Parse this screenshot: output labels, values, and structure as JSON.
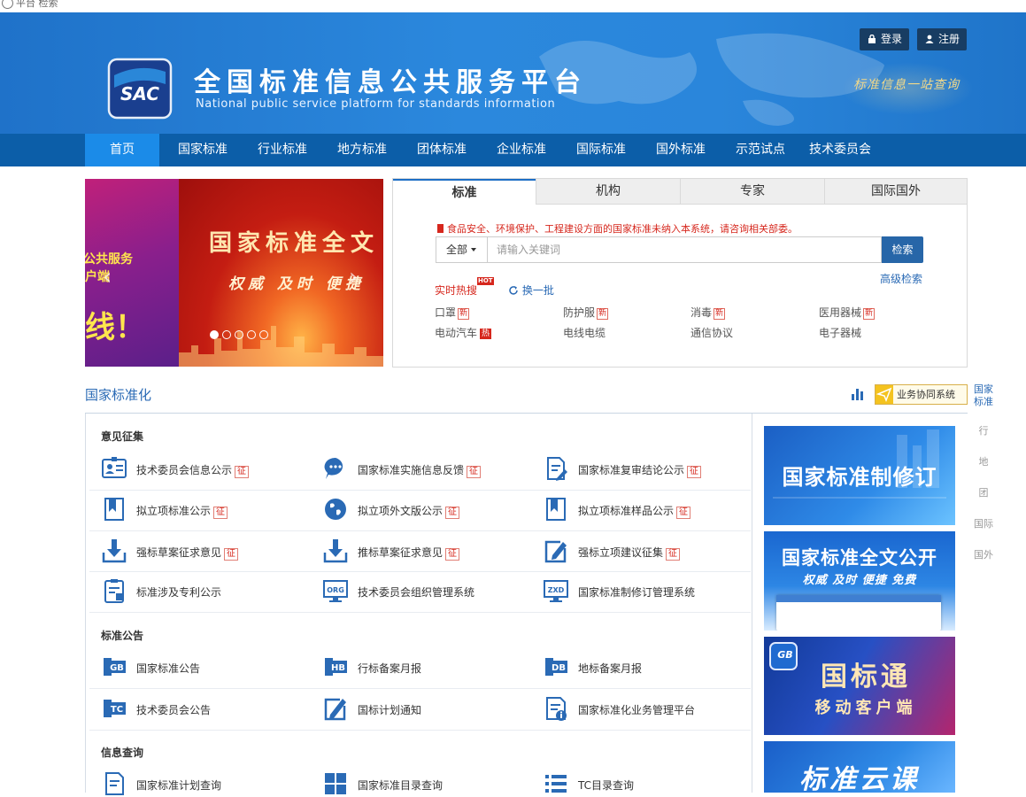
{
  "browser": {
    "tab_label": "平台 检索"
  },
  "header": {
    "login": "登录",
    "register": "注册",
    "logo_text": "SAC",
    "title": "全国标准信息公共服务平台",
    "subtitle": "National public service platform  for standards information",
    "slogan": "标准信息一站查询"
  },
  "nav": {
    "items": [
      "首页",
      "国家标准",
      "行业标准",
      "地方标准",
      "团体标准",
      "企业标准",
      "国际标准",
      "国外标准",
      "示范试点",
      "技术委员会"
    ],
    "active": "首页"
  },
  "banner": {
    "left_line1": "公共服务",
    "left_line2": "户端",
    "left_line3": "线！",
    "headline": "国家标准全文",
    "tagline": "权威  及时  便捷"
  },
  "search": {
    "tabs": [
      "标准",
      "机构",
      "专家",
      "国际国外"
    ],
    "active_tab": "标准",
    "notice": "食品安全、环境保护、工程建设方面的国家标准未纳入本系统，请咨询相关部委。",
    "scope": "全部",
    "placeholder": "请输入关键词",
    "button": "检索",
    "advanced": "高级检索",
    "hot_title": "实时热搜",
    "hot_badge": "HOT",
    "refresh": "换一批",
    "hot_terms": [
      {
        "text": "口罩",
        "tag": "新"
      },
      {
        "text": "防护服",
        "tag": "新"
      },
      {
        "text": "消毒",
        "tag": "新"
      },
      {
        "text": "医用器械",
        "tag": "新"
      },
      {
        "text": "电动汽车",
        "tag": "热"
      },
      {
        "text": "电线电缆",
        "tag": ""
      },
      {
        "text": "通信协议",
        "tag": ""
      },
      {
        "text": "电子器械",
        "tag": ""
      }
    ]
  },
  "section": {
    "title": "国家标准化",
    "collab_button": "业务协同系统"
  },
  "side_tabs": [
    "国家标准",
    "行",
    "地",
    "团",
    "国际",
    "国外"
  ],
  "groups": [
    {
      "title": "意见征集",
      "items": [
        {
          "label": "技术委员会信息公示",
          "tag": "征",
          "icon": "committee-card-icon"
        },
        {
          "label": "国家标准实施信息反馈",
          "tag": "征",
          "icon": "chat-bubble-icon"
        },
        {
          "label": "国家标准复审结论公示",
          "tag": "征",
          "icon": "document-edit-icon"
        },
        {
          "label": "拟立项标准公示",
          "tag": "征",
          "icon": "bookmark-icon"
        },
        {
          "label": "拟立项外文版公示",
          "tag": "征",
          "icon": "globe-icon"
        },
        {
          "label": "拟立项标准样品公示",
          "tag": "征",
          "icon": "bookmark-icon"
        },
        {
          "label": "强标草案征求意见",
          "tag": "征",
          "icon": "download-tray-icon"
        },
        {
          "label": "推标草案征求意见",
          "tag": "征",
          "icon": "download-tray-icon"
        },
        {
          "label": "强标立项建议征集",
          "tag": "征",
          "icon": "pencil-box-icon"
        },
        {
          "label": "标准涉及专利公示",
          "tag": "",
          "icon": "patent-doc-icon"
        },
        {
          "label": "技术委员会组织管理系统",
          "tag": "",
          "icon": "org-monitor-icon",
          "icon_text": "ORG"
        },
        {
          "label": "国家标准制修订管理系统",
          "tag": "",
          "icon": "zxd-monitor-icon",
          "icon_text": "ZXD"
        }
      ]
    },
    {
      "title": "标准公告",
      "items": [
        {
          "label": "国家标准公告",
          "tag": "",
          "icon": "gb-icon",
          "icon_text": "GB"
        },
        {
          "label": "行标备案月报",
          "tag": "",
          "icon": "hb-icon",
          "icon_text": "HB"
        },
        {
          "label": "地标备案月报",
          "tag": "",
          "icon": "db-icon",
          "icon_text": "DB"
        },
        {
          "label": "技术委员会公告",
          "tag": "",
          "icon": "tc-icon",
          "icon_text": "TC"
        },
        {
          "label": "国标计划通知",
          "tag": "",
          "icon": "plan-edit-icon"
        },
        {
          "label": "国家标准化业务管理平台",
          "tag": "",
          "icon": "info-doc-icon"
        }
      ]
    },
    {
      "title": "信息查询",
      "items": [
        {
          "label": "国家标准计划查询",
          "tag": "",
          "icon": "plan-doc-icon"
        },
        {
          "label": "国家标准目录查询",
          "tag": "",
          "icon": "grid-icon"
        },
        {
          "label": "TC目录查询",
          "tag": "",
          "icon": "list-icon"
        }
      ]
    }
  ],
  "promos": [
    {
      "title": "国家标准制修订",
      "sub": ""
    },
    {
      "title": "国家标准全文公开",
      "sub": "权威  及时  便捷  免费"
    },
    {
      "title": "国标通",
      "sub": "移动客户端",
      "badge": "GB"
    },
    {
      "title": "标准云课",
      "sub": ""
    }
  ],
  "colors": {
    "header_blue": "#2a86db",
    "nav_blue": "#0c5ea8",
    "nav_active": "#1b8be8",
    "link_blue": "#2a6ab5",
    "alert_red": "#d6271d"
  }
}
